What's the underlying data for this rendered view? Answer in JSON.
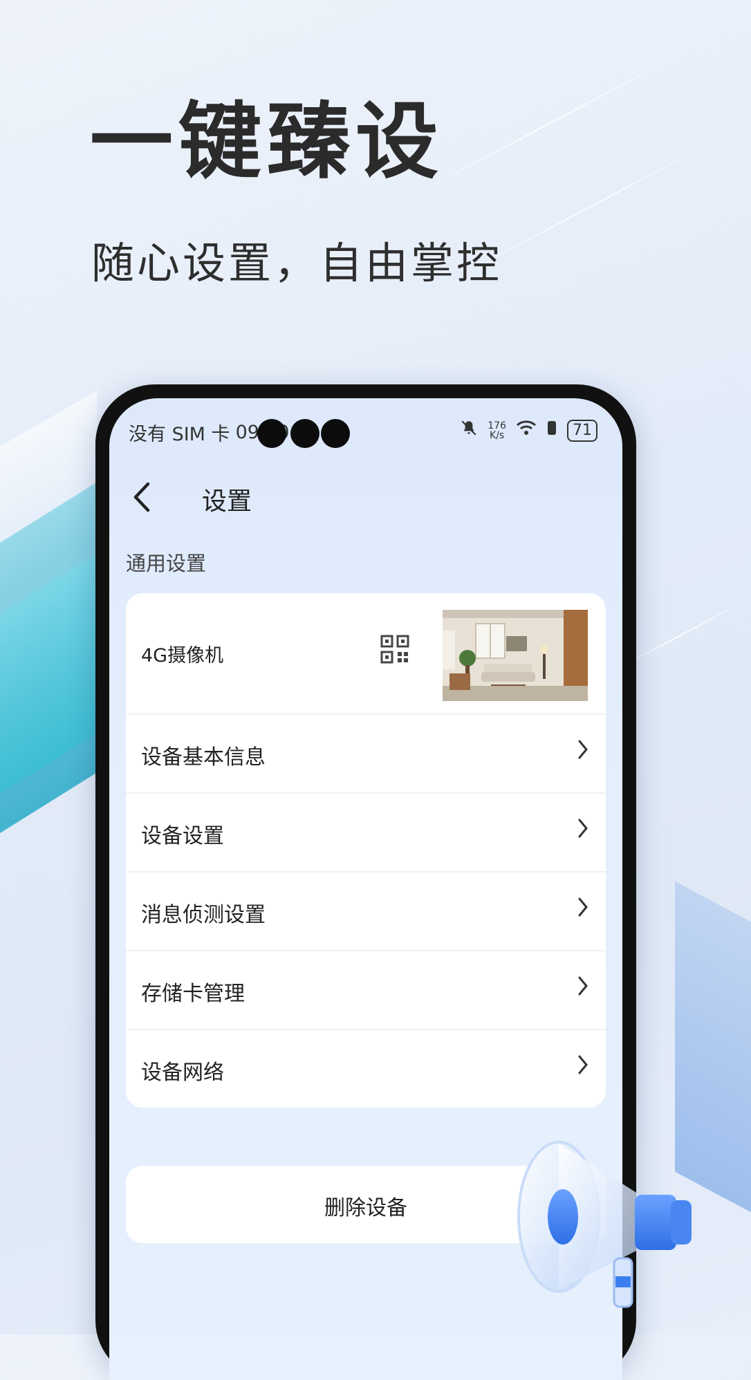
{
  "hero": {
    "title": "一键臻设",
    "subtitle": "随心设置，自由掌控"
  },
  "status_bar": {
    "carrier": "没有 SIM 卡",
    "time": "09:50",
    "net_speed_value": "176",
    "net_speed_unit": "K/s",
    "battery": "71"
  },
  "nav": {
    "back_icon": "chevron-left-icon",
    "title": "设置"
  },
  "general_settings": {
    "section_label": "通用设置",
    "device": {
      "name": "4G摄像机",
      "qr_icon": "qr-code-icon"
    },
    "items": [
      {
        "label": "设备基本信息"
      },
      {
        "label": "设备设置"
      },
      {
        "label": "消息侦测设置"
      },
      {
        "label": "存储卡管理"
      },
      {
        "label": "设备网络"
      }
    ]
  },
  "actions": {
    "delete_label": "删除设备"
  },
  "colors": {
    "accent_teal": "#2bb6cf",
    "megaphone_blue": "#3a7ff0",
    "background": "#e3ecf8"
  }
}
